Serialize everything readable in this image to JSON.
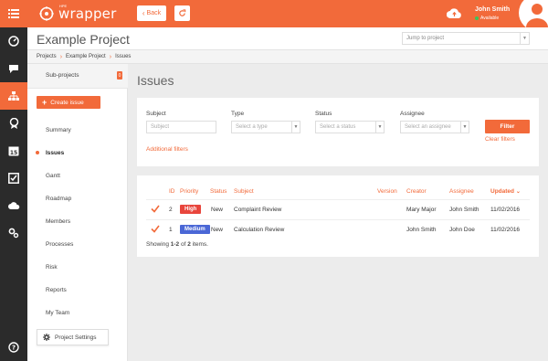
{
  "app": {
    "logo_text": "wrapper",
    "logo_small": "HPE",
    "back_label": "Back"
  },
  "user": {
    "name": "John Smith",
    "status": "Available"
  },
  "project": {
    "title": "Example Project",
    "jump_placeholder": "Jump to project"
  },
  "breadcrumb": [
    "Projects",
    "Example Project",
    "Issues"
  ],
  "sidebar": {
    "subprojects_label": "Sub-projects",
    "subprojects_count": "0",
    "create_label": "Create issue",
    "items": [
      {
        "label": "Summary"
      },
      {
        "label": "Issues"
      },
      {
        "label": "Gantt"
      },
      {
        "label": "Roadmap"
      },
      {
        "label": "Members"
      },
      {
        "label": "Processes"
      },
      {
        "label": "Risk"
      },
      {
        "label": "Reports"
      },
      {
        "label": "My Team"
      }
    ],
    "active": "Issues",
    "settings_label": "Project Settings"
  },
  "page": {
    "title": "Issues"
  },
  "filters": {
    "subject_label": "Subject",
    "subject_placeholder": "Subject",
    "type_label": "Type",
    "type_placeholder": "Select a type",
    "status_label": "Status",
    "status_placeholder": "Select a status",
    "assignee_label": "Assignee",
    "assignee_placeholder": "Select an assignee",
    "filter_button": "Filter",
    "clear_label": "Clear filters",
    "additional_label": "Additional filters"
  },
  "table": {
    "headers": {
      "id": "ID",
      "priority": "Priority",
      "status": "Status",
      "subject": "Subject",
      "version": "Version",
      "creator": "Creator",
      "assignee": "Assignee",
      "updated": "Updated"
    },
    "rows": [
      {
        "id": "2",
        "priority": "High",
        "status": "New",
        "subject": "Complaint Review",
        "version": "",
        "creator": "Mary Major",
        "assignee": "John Smith",
        "updated": "11/02/2016"
      },
      {
        "id": "1",
        "priority": "Medium",
        "status": "New",
        "subject": "Calculation Review",
        "version": "",
        "creator": "John Smith",
        "assignee": "John Doe",
        "updated": "11/02/2016"
      }
    ],
    "showing_prefix": "Showing",
    "showing_range": "1-2",
    "showing_of": "of",
    "showing_total": "2",
    "showing_suffix": "items."
  },
  "colors": {
    "accent": "#f26a3a",
    "rail": "#2b2b2b",
    "priority_high": "#e8453c",
    "priority_medium": "#4a67d6",
    "status_new": "#3bab3b"
  }
}
